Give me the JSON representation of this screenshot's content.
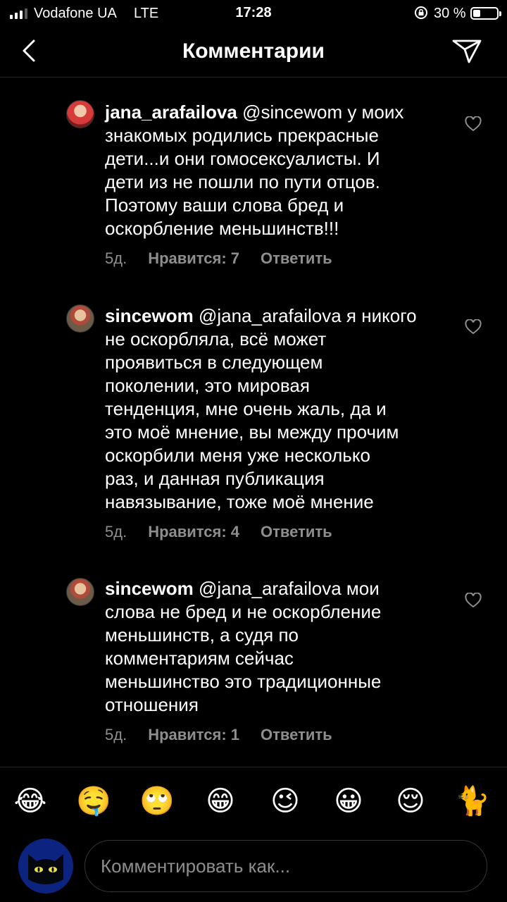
{
  "status_bar": {
    "carrier": "Vodafone UA",
    "network": "LTE",
    "time": "17:28",
    "battery": "30 %",
    "battery_level": 0.3
  },
  "header": {
    "title": "Комментарии",
    "back_icon": "chevron-left-icon",
    "send_icon": "paper-plane-icon"
  },
  "comments": [
    {
      "username": "jana_arafailova",
      "text": " @sincewom у моих\nзнакомых родились прекрасные\nдети...и они гомосексуалисты. И\nдети из не пошли по пути отцов.\nПоэтому ваши слова бред и\nоскорбление меньшинств!!!",
      "time": "5д.",
      "likes": "Нравится: 7",
      "reply": "Ответить"
    },
    {
      "username": "sincewom",
      "text": " @jana_arafailova я никого\nне оскорбляла, всё может\nпроявиться в следующем\nпоколении, это мировая\nтенденция, мне очень жаль, да и\nэто моё мнение, вы между прочим\nоскорбили меня уже несколько\nраз, и данная публикация\nнавязывание, тоже моё мнение",
      "time": "5д.",
      "likes": "Нравится: 4",
      "reply": "Ответить"
    },
    {
      "username": "sincewom",
      "text": " @jana_arafailova мои\nслова не бред и не оскорбление\nменьшинств, а судя по\nкомментариям сейчас\nменьшинство это традиционные\nотношения",
      "time": "5д.",
      "likes": "Нравится: 1",
      "reply": "Ответить"
    }
  ],
  "emojis": [
    "😂",
    "🤤",
    "🙄",
    "😁",
    "😉",
    "😀",
    "😌",
    "🐈"
  ],
  "composer": {
    "placeholder": "Комментировать как..."
  },
  "colors": {
    "background": "#000000",
    "secondary_text": "#8e8e8e",
    "border": "#363636"
  }
}
